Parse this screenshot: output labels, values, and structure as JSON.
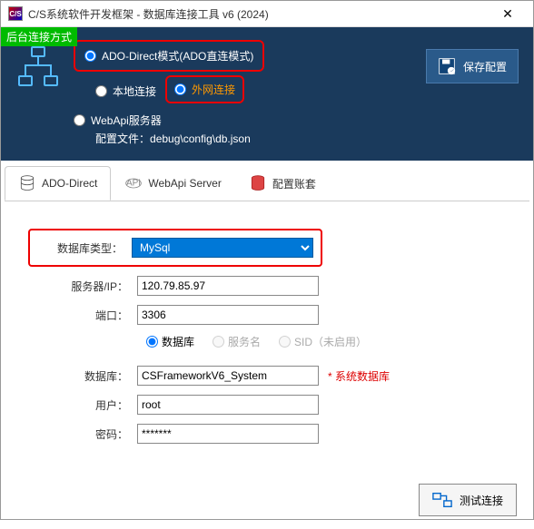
{
  "titlebar": {
    "icon_text": "C/S",
    "title": "C/S系统软件开发框架 - 数据库连接工具 v6 (2024)"
  },
  "top": {
    "badge": "后台连接方式",
    "mode_ado": "ADO-Direct模式(ADO直连模式)",
    "mode_local": "本地连接",
    "mode_external": "外网连接",
    "mode_webapi": "WebApi服务器",
    "config_label": "配置文件：",
    "config_path": "debug\\config\\db.json",
    "save_btn": "保存配置"
  },
  "tabs": {
    "ado": "ADO-Direct",
    "webapi": "WebApi Server",
    "account": "配置账套"
  },
  "form": {
    "db_type_label": "数据库类型：",
    "db_type_value": "MySql",
    "server_label": "服务器/IP：",
    "server_value": "120.79.85.97",
    "port_label": "端口：",
    "port_value": "3306",
    "opt_db": "数据库",
    "opt_service": "服务名",
    "opt_sid": "SID（未启用）",
    "db_label": "数据库：",
    "db_value": "CSFrameworkV6_System",
    "db_note": "* 系统数据库",
    "user_label": "用户：",
    "user_value": "root",
    "pwd_label": "密码：",
    "pwd_value": "*******"
  },
  "footer": {
    "test_btn": "测试连接"
  }
}
